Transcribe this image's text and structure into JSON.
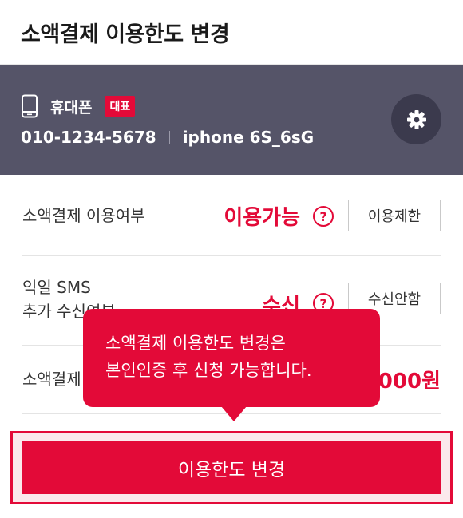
{
  "header": {
    "title": "소액결제 이용한도 변경"
  },
  "device": {
    "type_label": "휴대폰",
    "badge": "대표",
    "phone_number": "010-1234-5678",
    "model": "iphone 6S_6sG",
    "icons": {
      "device": "mobile-phone-icon",
      "settings": "gear-icon"
    }
  },
  "rows": {
    "payment": {
      "label": "소액결제 이용여부",
      "status": "이용가능",
      "help": "?",
      "button": "이용제한"
    },
    "sms": {
      "label_line1": "익일 SMS",
      "label_line2": "추가 수신여부",
      "status": "수신",
      "help": "?",
      "button": "수신안함"
    },
    "limit": {
      "label": "소액결제",
      "value": "000원"
    }
  },
  "tooltip": {
    "line1": "소액결제 이용한도 변경은",
    "line2": "본인인증 후 신청 가능합니다."
  },
  "cta": {
    "label": "이용한도 변경"
  },
  "colors": {
    "accent": "#e30a38",
    "device_bg": "#555468",
    "gear_bg": "#3b3a4d"
  }
}
